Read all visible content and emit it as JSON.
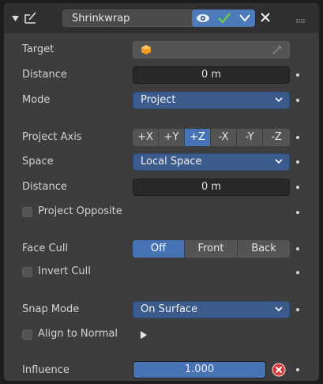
{
  "header": {
    "modifier_name": "Shrinkwrap",
    "menu_icon": "grip-icon"
  },
  "rows": {
    "target_label": "Target",
    "distance_label": "Distance",
    "distance_value": "0 m",
    "mode_label": "Mode",
    "mode_value": "Project",
    "project_axis_label": "Project Axis",
    "axes": [
      "+X",
      "+Y",
      "+Z",
      "-X",
      "-Y",
      "-Z"
    ],
    "active_axis": "+Z",
    "space_label": "Space",
    "space_value": "Local Space",
    "distance2_label": "Distance",
    "distance2_value": "0 m",
    "project_opposite_label": "Project Opposite",
    "face_cull_label": "Face Cull",
    "face_cull_options": [
      "Off",
      "Front",
      "Back"
    ],
    "face_cull_active": "Off",
    "invert_cull_label": "Invert Cull",
    "snap_mode_label": "Snap Mode",
    "snap_mode_value": "On Surface",
    "align_normal_label": "Align to Normal",
    "influence_label": "Influence",
    "influence_value": "1.000",
    "influence_fraction": 1.0
  },
  "colors": {
    "accent": "#4772b3",
    "check_green": "#6bd14a",
    "error_red": "#d63a3a"
  }
}
